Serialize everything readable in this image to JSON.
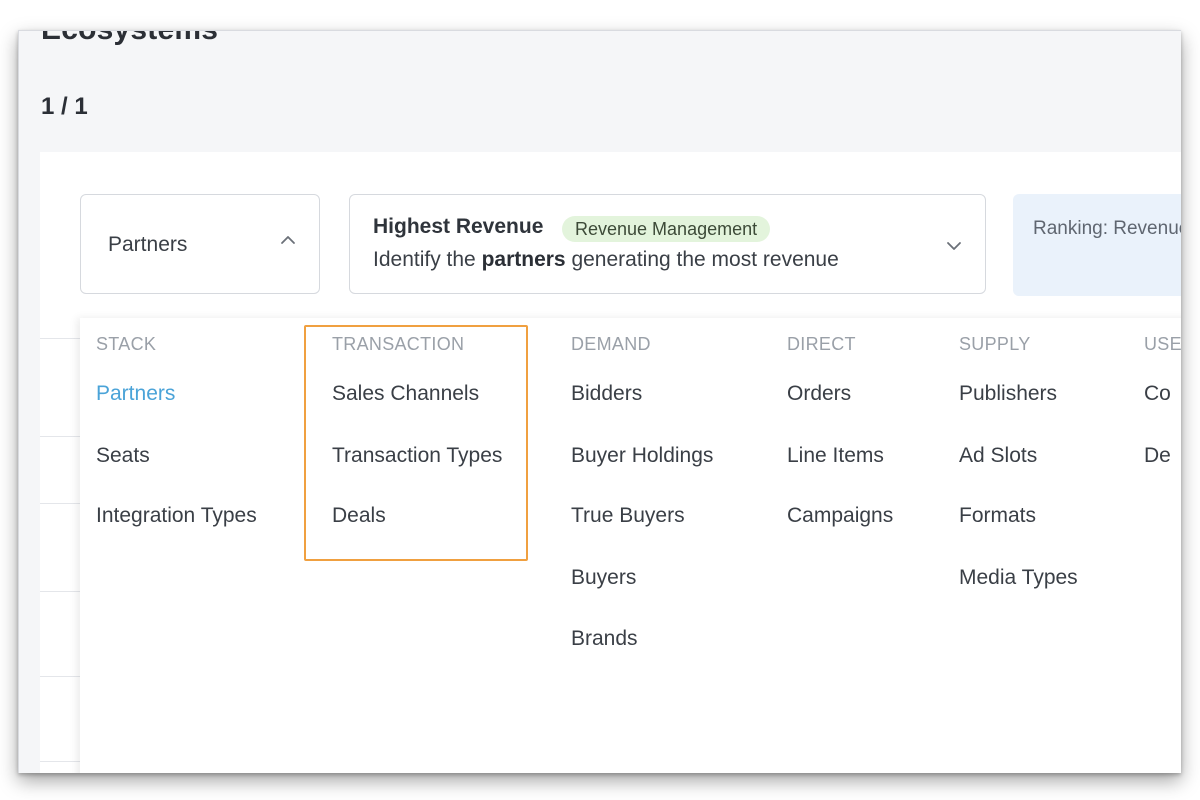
{
  "page": {
    "title": "Ecosystems",
    "pager": "1 / 1"
  },
  "dimension_select": {
    "value": "Partners",
    "chevron_icon": "chevron-up-icon"
  },
  "insight_select": {
    "title": "Highest Revenue",
    "badge": "Revenue Management",
    "description_prefix": "Identify the ",
    "description_bold": "partners",
    "description_suffix": " generating the most revenue",
    "chevron_icon": "chevron-down-icon"
  },
  "ranking": {
    "text": "Ranking: Revenue"
  },
  "menu": {
    "columns": [
      {
        "header": "STACK",
        "items": [
          "Partners",
          "Seats",
          "Integration Types"
        ]
      },
      {
        "header": "TRANSACTION",
        "items": [
          "Sales Channels",
          "Transaction Types",
          "Deals"
        ]
      },
      {
        "header": "DEMAND",
        "items": [
          "Bidders",
          "Buyer Holdings",
          "True Buyers",
          "Buyers",
          "Brands"
        ]
      },
      {
        "header": "DIRECT",
        "items": [
          "Orders",
          "Line Items",
          "Campaigns"
        ]
      },
      {
        "header": "SUPPLY",
        "items": [
          "Publishers",
          "Ad Slots",
          "Formats",
          "Media Types"
        ]
      },
      {
        "header": "USER",
        "items": [
          "Co",
          "De"
        ]
      }
    ],
    "active_item": "Partners"
  },
  "colors": {
    "active_link": "#4aa3d8",
    "highlight_border": "#f0a040",
    "badge_background": "#e3f4dc",
    "ranking_background": "#eaf2fb"
  }
}
